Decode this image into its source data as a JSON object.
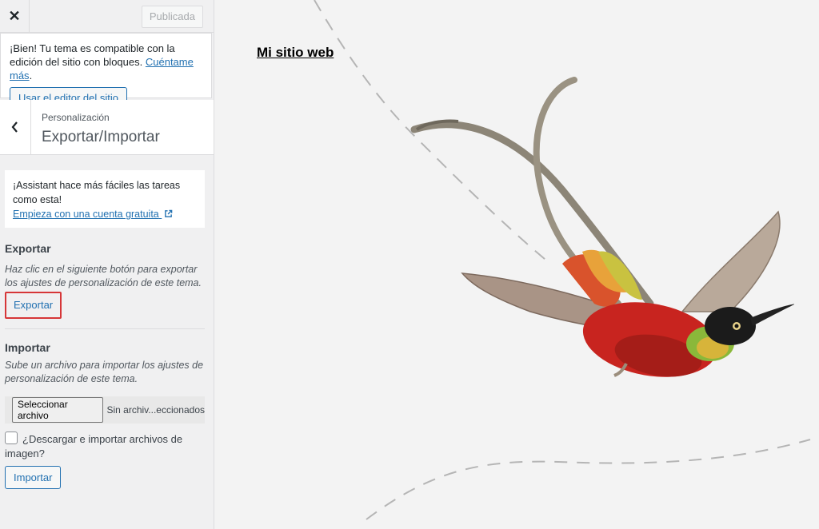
{
  "topbar": {
    "close_icon": "close-icon",
    "publish_label": "Publicada"
  },
  "notice": {
    "text": "¡Bien! Tu tema es compatible con la edición del sitio con bloques.",
    "link": "Cuéntame más",
    "period": ".",
    "button": "Usar el editor del sitio"
  },
  "section": {
    "breadcrumb": "Personalización",
    "title": "Exportar/Importar",
    "back_icon": "chevron-left-icon"
  },
  "assistant": {
    "text": "¡Assistant hace más fáciles las tareas como esta!",
    "link": "Empieza con una cuenta gratuita",
    "link_icon": "external-link-icon"
  },
  "export": {
    "heading": "Exportar",
    "description": "Haz clic en el siguiente botón para exportar los ajustes de personalización de este tema.",
    "button": "Exportar"
  },
  "import": {
    "heading": "Importar",
    "description": "Sube un archivo para importar los ajustes de personalización de este tema.",
    "file_button": "Seleccionar archivo",
    "file_status": "Sin archiv...eccionados",
    "checkbox_label": "¿Descargar e importar archivos de imagen?",
    "button": "Importar"
  },
  "preview": {
    "site_title": "Mi sitio web"
  },
  "colors": {
    "accent": "#2271b1",
    "highlight": "#d63638"
  }
}
